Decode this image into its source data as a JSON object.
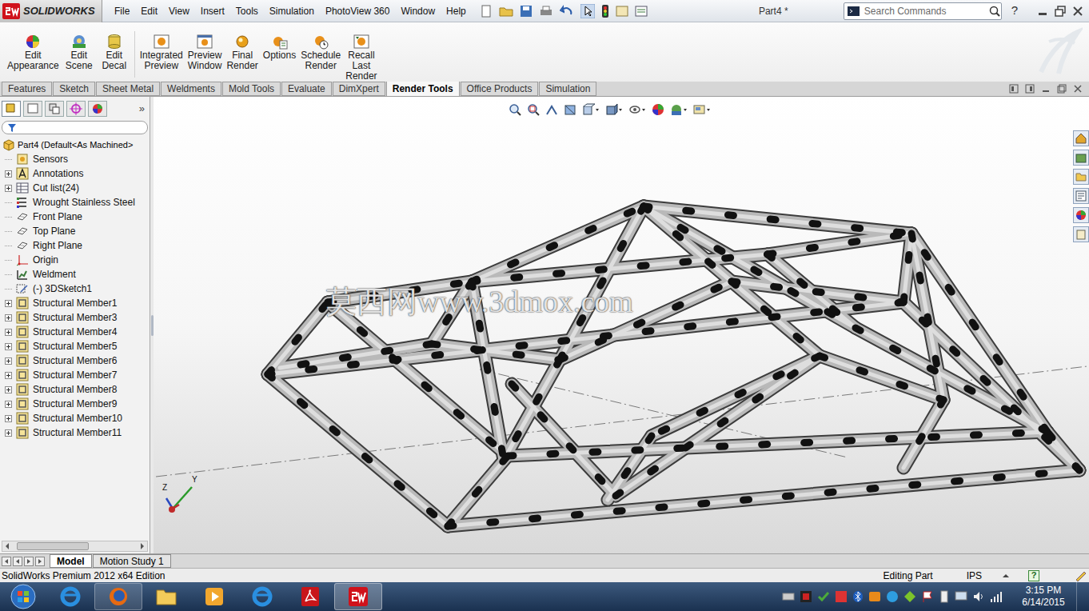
{
  "app": {
    "logo": "SOLIDWORKS",
    "title": "Part4 *"
  },
  "menu": [
    "File",
    "Edit",
    "View",
    "Insert",
    "Tools",
    "Simulation",
    "PhotoView 360",
    "Window",
    "Help"
  ],
  "search": {
    "placeholder": "Search Commands"
  },
  "help": "?",
  "ribbon": [
    {
      "lines": [
        "Edit",
        "Appearance"
      ]
    },
    {
      "lines": [
        "Edit",
        "Scene"
      ]
    },
    {
      "lines": [
        "Edit",
        "Decal"
      ]
    },
    {
      "lines": [
        "Integrated",
        "Preview"
      ]
    },
    {
      "lines": [
        "Preview",
        "Window"
      ]
    },
    {
      "lines": [
        "Final",
        "Render"
      ]
    },
    {
      "lines": [
        "Options"
      ]
    },
    {
      "lines": [
        "Schedule",
        "Render"
      ]
    },
    {
      "lines": [
        "Recall",
        "Last",
        "Render"
      ]
    }
  ],
  "tabs": [
    {
      "label": "Features",
      "selected": false
    },
    {
      "label": "Sketch",
      "selected": false
    },
    {
      "label": "Sheet Metal",
      "selected": false
    },
    {
      "label": "Weldments",
      "selected": false
    },
    {
      "label": "Mold Tools",
      "selected": false
    },
    {
      "label": "Evaluate",
      "selected": false
    },
    {
      "label": "DimXpert",
      "selected": false
    },
    {
      "label": "Render Tools",
      "selected": true
    },
    {
      "label": "Office Products",
      "selected": false
    },
    {
      "label": "Simulation",
      "selected": false
    }
  ],
  "tree": {
    "root": "Part4  (Default<As Machined>",
    "items": [
      {
        "label": "Sensors",
        "expandable": false,
        "kind": "sensor"
      },
      {
        "label": "Annotations",
        "expandable": true,
        "kind": "annotation"
      },
      {
        "label": "Cut list(24)",
        "expandable": true,
        "kind": "cutlist"
      },
      {
        "label": "Wrought Stainless Steel",
        "expandable": false,
        "kind": "material"
      },
      {
        "label": "Front Plane",
        "expandable": false,
        "kind": "plane"
      },
      {
        "label": "Top Plane",
        "expandable": false,
        "kind": "plane"
      },
      {
        "label": "Right Plane",
        "expandable": false,
        "kind": "plane"
      },
      {
        "label": "Origin",
        "expandable": false,
        "kind": "origin"
      },
      {
        "label": "Weldment",
        "expandable": false,
        "kind": "weldment"
      },
      {
        "label": "(-) 3DSketch1",
        "expandable": false,
        "kind": "sketch"
      },
      {
        "label": "Structural Member1",
        "expandable": true,
        "kind": "member"
      },
      {
        "label": "Structural Member3",
        "expandable": true,
        "kind": "member"
      },
      {
        "label": "Structural Member4",
        "expandable": true,
        "kind": "member"
      },
      {
        "label": "Structural Member5",
        "expandable": true,
        "kind": "member"
      },
      {
        "label": "Structural Member6",
        "expandable": true,
        "kind": "member"
      },
      {
        "label": "Structural Member7",
        "expandable": true,
        "kind": "member"
      },
      {
        "label": "Structural Member8",
        "expandable": true,
        "kind": "member"
      },
      {
        "label": "Structural Member9",
        "expandable": true,
        "kind": "member"
      },
      {
        "label": "Structural Member10",
        "expandable": true,
        "kind": "member"
      },
      {
        "label": "Structural Member11",
        "expandable": true,
        "kind": "member"
      }
    ]
  },
  "watermark": "莫西网www.3dmox.com",
  "triad": [
    "Z",
    "Y"
  ],
  "bottom_tabs": [
    {
      "label": "Model",
      "selected": true
    },
    {
      "label": "Motion Study 1",
      "selected": false
    }
  ],
  "status_bar": {
    "left": "SolidWorks Premium 2012 x64 Edition",
    "mode": "Editing Part",
    "units": "IPS",
    "help": "?"
  },
  "taskbar": {
    "time": "3:15 PM",
    "date": "6/14/2015"
  }
}
